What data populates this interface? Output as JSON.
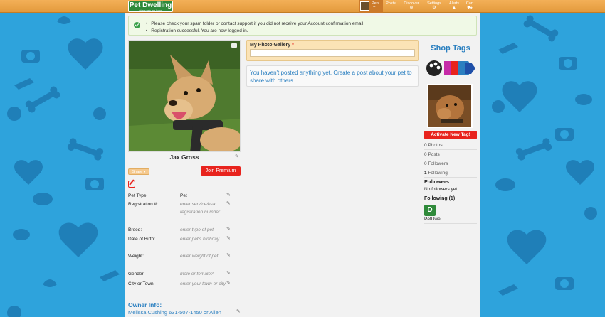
{
  "header": {
    "logo_name": "Pet Dwelling",
    "logo_tagline": "where pets are home",
    "nav": [
      {
        "label": "Pets",
        "glyph": "+"
      },
      {
        "label": "Posts",
        "glyph": ""
      },
      {
        "label": "Discover",
        "glyph": "⊕"
      },
      {
        "label": "Settings",
        "glyph": "⚙"
      },
      {
        "label": "Alerts",
        "glyph": "▲"
      },
      {
        "label": "Cart",
        "glyph": "⛟"
      }
    ]
  },
  "notice": {
    "messages": [
      "Please check your spam folder or contact support if you did not receive your Account confirmation email.",
      "Registration successful. You are now logged in."
    ]
  },
  "profile": {
    "pet_name": "Jax Gross",
    "share_label": "Share ▾",
    "join_label": "Join Premium",
    "fields": [
      {
        "label": "Pet Type:",
        "value": "Pet",
        "placeholder": false
      },
      {
        "label": "Registration #:",
        "value": "enter service/esa registration number",
        "placeholder": true
      },
      {
        "label": "Breed:",
        "value": "enter type of pet",
        "placeholder": true
      },
      {
        "label": "Date of Birth:",
        "value": "enter pet's birthday",
        "placeholder": true
      },
      {
        "label": "Weight:",
        "value": "enter weight of pet",
        "placeholder": true
      },
      {
        "label": "Gender:",
        "value": "male or female?",
        "placeholder": true
      },
      {
        "label": "City or Town:",
        "value": "enter your town or city",
        "placeholder": true
      }
    ],
    "owner_title": "Owner Info:",
    "owner_info": "Melissa Cushing 631-507-1450 or Allen"
  },
  "gallery": {
    "title": "My Photo Gallery",
    "required_mark": "*",
    "empty_message": "You haven't posted anything yet. Create a post about your pet to share with others."
  },
  "sidebar": {
    "shop_title": "Shop Tags",
    "activate_label": "Activate New Tag!",
    "stats": [
      {
        "count": "0",
        "label": "Photos",
        "bold": false
      },
      {
        "count": "0",
        "label": "Posts",
        "bold": false
      },
      {
        "count": "0",
        "label": "Followers",
        "bold": false
      },
      {
        "count": "1",
        "label": "Following",
        "bold": true
      }
    ],
    "followers_title": "Followers",
    "followers_note": "No followers yet.",
    "following_title": "Following (1)",
    "following_icon_letter": "D",
    "following_name": "PetDwel..."
  },
  "colors": {
    "header_orange": "#e39a3c",
    "brand_green": "#2f8a3a",
    "link_blue": "#2a7fc0",
    "premium_red": "#e8231d",
    "background_blue": "#2ea3dc"
  }
}
